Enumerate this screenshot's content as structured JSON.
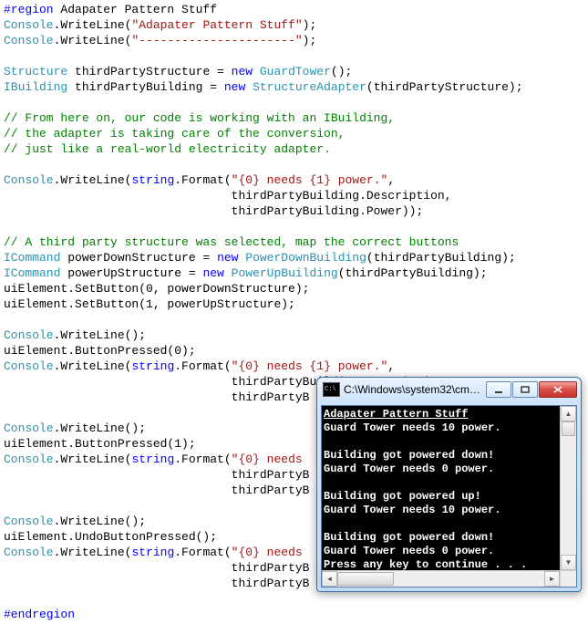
{
  "code": {
    "region_start": "#region",
    "region_title": " Adapater Pattern Stuff",
    "l1a": "Console",
    "l1b": ".WriteLine(",
    "l1c": "\"Adapater Pattern Stuff\"",
    "l1d": ");",
    "l2a": "Console",
    "l2b": ".WriteLine(",
    "l2c": "\"----------------------\"",
    "l2d": ");",
    "l3a": "Structure",
    "l3b": " thirdPartyStructure = ",
    "l3c": "new",
    "l3d": " ",
    "l3e": "GuardTower",
    "l3f": "();",
    "l4a": "IBuilding",
    "l4b": " thirdPartyBuilding = ",
    "l4c": "new",
    "l4d": " ",
    "l4e": "StructureAdapter",
    "l4f": "(thirdPartyStructure);",
    "c1": "// From here on, our code is working with an IBuilding,",
    "c2": "// the adapter is taking care of the conversion,",
    "c3": "// just like a real-world electricity adapter.",
    "l5a": "Console",
    "l5b": ".WriteLine(",
    "l5c": "string",
    "l5d": ".Format(",
    "l5e": "\"{0} needs {1} power.\"",
    "l5f": ",",
    "l5g": "                                thirdPartyBuilding.Description,",
    "l5h": "                                thirdPartyBuilding.Power));",
    "c4": "// A third party structure was selected, map the correct buttons",
    "l6a": "ICommand",
    "l6b": " powerDownStructure = ",
    "l6c": "new",
    "l6d": " ",
    "l6e": "PowerDownBuilding",
    "l6f": "(thirdPartyBuilding);",
    "l7a": "ICommand",
    "l7b": " powerUpStructure = ",
    "l7c": "new",
    "l7d": " ",
    "l7e": "PowerUpBuilding",
    "l7f": "(thirdPartyBuilding);",
    "l8": "uiElement.SetButton(0, powerDownStructure);",
    "l9": "uiElement.SetButton(1, powerUpStructure);",
    "l10a": "Console",
    "l10b": ".WriteLine();",
    "l11": "uiElement.ButtonPressed(0);",
    "l12a": "Console",
    "l12b": ".WriteLine(",
    "l12c": "string",
    "l12d": ".Format(",
    "l12e": "\"{0} needs {1} power.\"",
    "l12f": ",",
    "l12g": "                                thirdPartyBuilding.Description,",
    "l12h": "                                thirdPartyB",
    "l13a": "Console",
    "l13b": ".WriteLine();",
    "l14": "uiElement.ButtonPressed(1);",
    "l15a": "Console",
    "l15b": ".WriteLine(",
    "l15c": "string",
    "l15d": ".Format(",
    "l15e": "\"{0} needs ",
    "l15g": "                                thirdPartyB",
    "l15h": "                                thirdPartyB",
    "l16a": "Console",
    "l16b": ".WriteLine();",
    "l17": "uiElement.UndoButtonPressed();",
    "l18a": "Console",
    "l18b": ".WriteLine(",
    "l18c": "string",
    "l18d": ".Format(",
    "l18e": "\"{0} needs ",
    "l18g": "                                thirdPartyB",
    "l18h": "                                thirdPartyB",
    "endregion": "#endregion"
  },
  "console": {
    "icon_text": "C:\\",
    "title": "C:\\Windows\\system32\\cmd....",
    "lines": [
      "Adapater Pattern Stuff",
      "----------------------",
      "Guard Tower needs 10 power.",
      "",
      "Building got powered down!",
      "Guard Tower needs 0 power.",
      "",
      "Building got powered up!",
      "Guard Tower needs 10 power.",
      "",
      "Building got powered down!",
      "Guard Tower needs 0 power.",
      "Press any key to continue . . ."
    ]
  }
}
